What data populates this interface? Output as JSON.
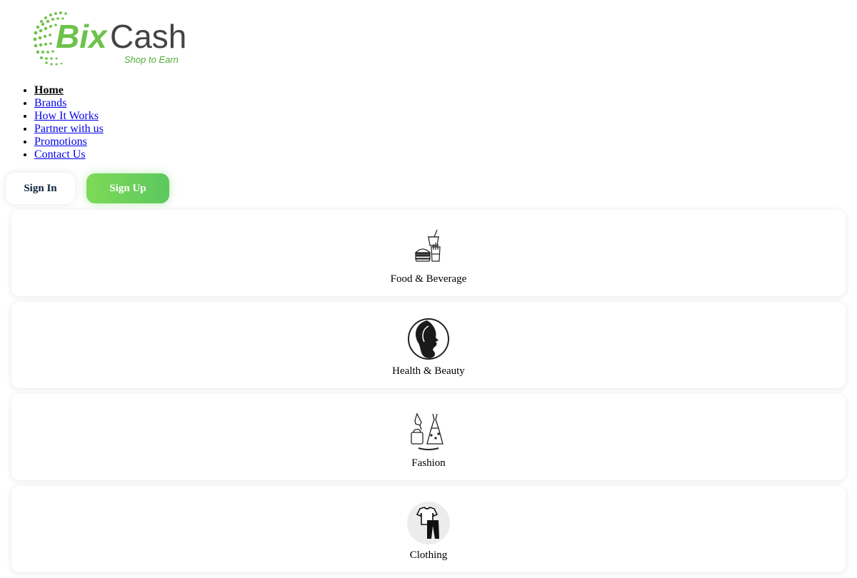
{
  "brand": {
    "name_part1": "Bix",
    "name_part2": "Cash",
    "tagline": "Shop to Earn",
    "colors": {
      "green": "#6cc24a",
      "dark_green": "#4fae3b",
      "text_gray": "#444444"
    }
  },
  "nav": {
    "items": [
      {
        "label": "Home",
        "active": true
      },
      {
        "label": "Brands",
        "active": false
      },
      {
        "label": "How It Works",
        "active": false
      },
      {
        "label": "Partner with us",
        "active": false
      },
      {
        "label": "Promotions",
        "active": false
      },
      {
        "label": "Contact Us",
        "active": false
      }
    ]
  },
  "auth": {
    "sign_in_label": "Sign In",
    "sign_up_label": "Sign Up",
    "sign_up_color": "#6fd05a"
  },
  "categories": [
    {
      "label": "Food & Beverage",
      "icon": "food-beverage-icon"
    },
    {
      "label": "Health & Beauty",
      "icon": "woman-profile-icon"
    },
    {
      "label": "Fashion",
      "icon": "dress-heels-handbag-icon"
    },
    {
      "label": "Clothing",
      "icon": "shirt-pants-icon"
    }
  ]
}
